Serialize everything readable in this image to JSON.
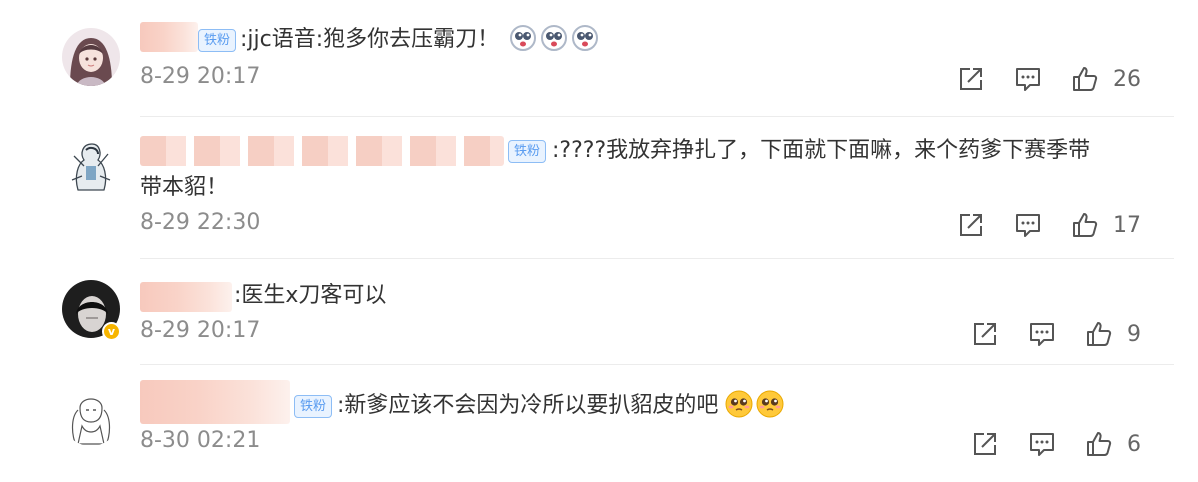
{
  "comments": [
    {
      "badge": "铁粉",
      "text": ":jjc语音:狍多你去压霸刀！",
      "emoji_icons": [
        "crying-face-icon",
        "crying-face-icon",
        "crying-face-icon"
      ],
      "time": "8-29 20:17",
      "likes": "26"
    },
    {
      "badge": "铁粉",
      "text_line1": ":????我放弃挣扎了，下面就下面嘛，来个药爹下赛季带",
      "text_line2": "带本貂！",
      "time": "8-29 22:30",
      "likes": "17"
    },
    {
      "text": ":医生x刀客可以",
      "verified_icon": "verified-badge-icon",
      "time": "8-29 20:17",
      "likes": "9"
    },
    {
      "badge": "铁粉",
      "text": ":新爹应该不会因为冷所以要扒貂皮的吧",
      "emoji_icons": [
        "pleading-face-icon",
        "pleading-face-icon"
      ],
      "time": "8-30 02:21",
      "likes": "6"
    }
  ],
  "colors": {
    "badge_blue": "#5a9cf0",
    "name_blur_pink": "#f7c9bd",
    "time_gray": "#8c8c8c",
    "verified_yellow": "#f7b500"
  }
}
